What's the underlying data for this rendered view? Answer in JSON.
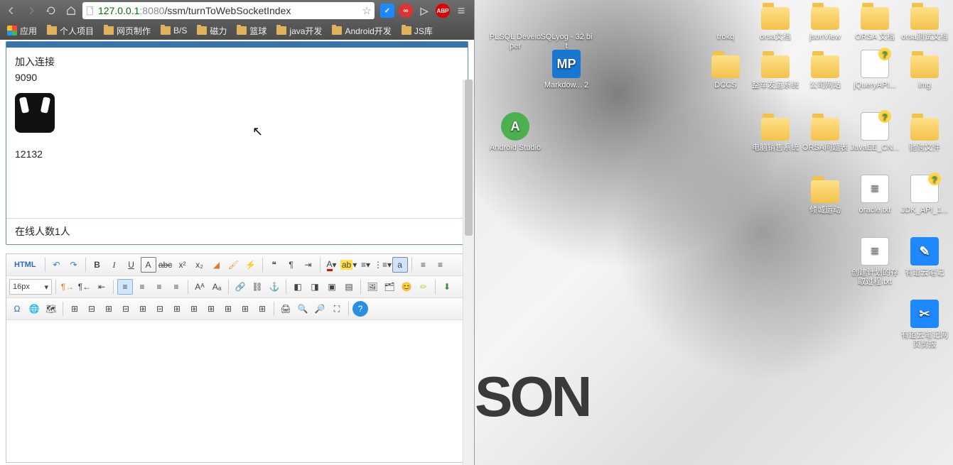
{
  "browser": {
    "url_host": "127.0.0.1",
    "url_port": ":8080",
    "url_path": "/ssm/turnToWebSocketIndex",
    "bookmarks": {
      "apps": "应用",
      "folders": [
        "个人项目",
        "网页制作",
        "B/S",
        "磁力",
        "篮球",
        "java开发",
        "Android开发",
        "JS库"
      ]
    },
    "ext_abp": "ABP"
  },
  "chat": {
    "line1": "加入连接",
    "line2": "9090",
    "line3": "12132",
    "online": "在线人数1人"
  },
  "editor": {
    "html_btn": "HTML",
    "font_size": "16px",
    "font_label": "A",
    "bg_label": "ab"
  },
  "desktop": {
    "bg_text": "SON",
    "row0": [
      {
        "label": "PLSQL Developer",
        "cls": "plsql"
      },
      {
        "label": "SQLyog - 32 bit",
        "cls": "sqlyog"
      },
      {
        "label": "trokq",
        "cls": "trokq"
      },
      {
        "label": "orsa文档",
        "cls": "folder"
      },
      {
        "label": "jsonView",
        "cls": "folder"
      },
      {
        "label": "ORSA 文档",
        "cls": "folder"
      },
      {
        "label": "orsa测试文档",
        "cls": "folder"
      }
    ],
    "row1": [
      {
        "label": "Markdow... 2",
        "cls": "app-mp",
        "txt": "MP"
      },
      {
        "label": "DCCS",
        "cls": "folder"
      },
      {
        "label": "整车发运系统",
        "cls": "folder"
      },
      {
        "label": "公司网站",
        "cls": "folder"
      },
      {
        "label": "jQueryAPI...",
        "cls": "chm"
      },
      {
        "label": "img",
        "cls": "folder"
      }
    ],
    "row2": [
      {
        "label": "Android Studio",
        "cls": "app-as",
        "txt": "A"
      },
      {
        "label": "电脑销售系统",
        "cls": "folder"
      },
      {
        "label": "ORSA问题表",
        "cls": "folder"
      },
      {
        "label": "JavaEE_CN...",
        "cls": "chm"
      },
      {
        "label": "驰骋文件",
        "cls": "folder"
      }
    ],
    "row3": [
      {
        "label": "倾城运动",
        "cls": "folder"
      },
      {
        "label": "oracle.txt",
        "cls": "txt"
      },
      {
        "label": "JDK_API_1...",
        "cls": "chm"
      }
    ],
    "row4": [
      {
        "label": "创建计划的存取过程.txt",
        "cls": "txt"
      },
      {
        "label": "有道云笔记",
        "cls": "app-yd",
        "txt": "✎"
      }
    ],
    "row5": [
      {
        "label": "有道云笔记网页剪报",
        "cls": "app-yd",
        "txt": "✂"
      }
    ]
  }
}
